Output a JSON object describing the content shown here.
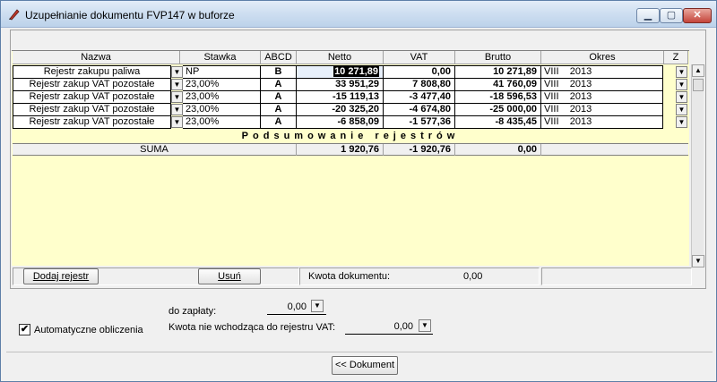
{
  "window": {
    "title": "Uzupełnianie dokumentu FVP1",
    "buffer": "47 w buforze",
    "buttons": {
      "minimize": "▭",
      "maximize": "▢",
      "close": "✕"
    }
  },
  "columns": {
    "nazwa": "Nazwa",
    "stawka": "Stawka",
    "abcd": "ABCD",
    "netto": "Netto",
    "vat": "VAT",
    "brutto": "Brutto",
    "okres": "Okres",
    "z": "Z"
  },
  "rows": [
    {
      "nazwa": "Rejestr zakupu paliwa",
      "stawka": "NP",
      "abcd": "B",
      "netto": "10 271,89",
      "vat": "0,00",
      "brutto": "10 271,89",
      "okres_m": "VIII",
      "okres_y": "2013"
    },
    {
      "nazwa": "Rejestr zakup VAT pozostałe",
      "stawka": "23,00%",
      "abcd": "A",
      "netto": "33 951,29",
      "vat": "7 808,80",
      "brutto": "41 760,09",
      "okres_m": "VIII",
      "okres_y": "2013"
    },
    {
      "nazwa": "Rejestr zakup VAT pozostałe",
      "stawka": "23,00%",
      "abcd": "A",
      "netto": "-15 119,13",
      "vat": "-3 477,40",
      "brutto": "-18 596,53",
      "okres_m": "VIII",
      "okres_y": "2013"
    },
    {
      "nazwa": "Rejestr zakup VAT pozostałe",
      "stawka": "23,00%",
      "abcd": "A",
      "netto": "-20 325,20",
      "vat": "-4 674,80",
      "brutto": "-25 000,00",
      "okres_m": "VIII",
      "okres_y": "2013"
    },
    {
      "nazwa": "Rejestr zakup VAT pozostałe",
      "stawka": "23,00%",
      "abcd": "A",
      "netto": "-6 858,09",
      "vat": "-1 577,36",
      "brutto": "-8 435,45",
      "okres_m": "VIII",
      "okres_y": "2013"
    }
  ],
  "summary": {
    "title": "Podsumowanie rejestrów",
    "label": "SUMA",
    "netto": "1 920,76",
    "vat": "-1 920,76",
    "brutto": "0,00"
  },
  "footer": {
    "add_button": "Dodaj rejestr",
    "remove_button": "Usuń",
    "kwota_label": "Kwota dokumentu:",
    "kwota_value": "0,00"
  },
  "form": {
    "do_zaplaty_label": "do zapłaty:",
    "do_zaplaty_value": "0,00",
    "kwota_nie_label": "Kwota nie wchodząca do rejestru VAT:",
    "kwota_nie_value": "0,00",
    "auto_label": "Automatyczne obliczenia",
    "auto_checked": true
  },
  "dokument_button": "<< Dokument",
  "icons": {
    "dropdown": "▼",
    "scroll_up": "▲",
    "scroll_down": "▼",
    "check": "✔"
  }
}
